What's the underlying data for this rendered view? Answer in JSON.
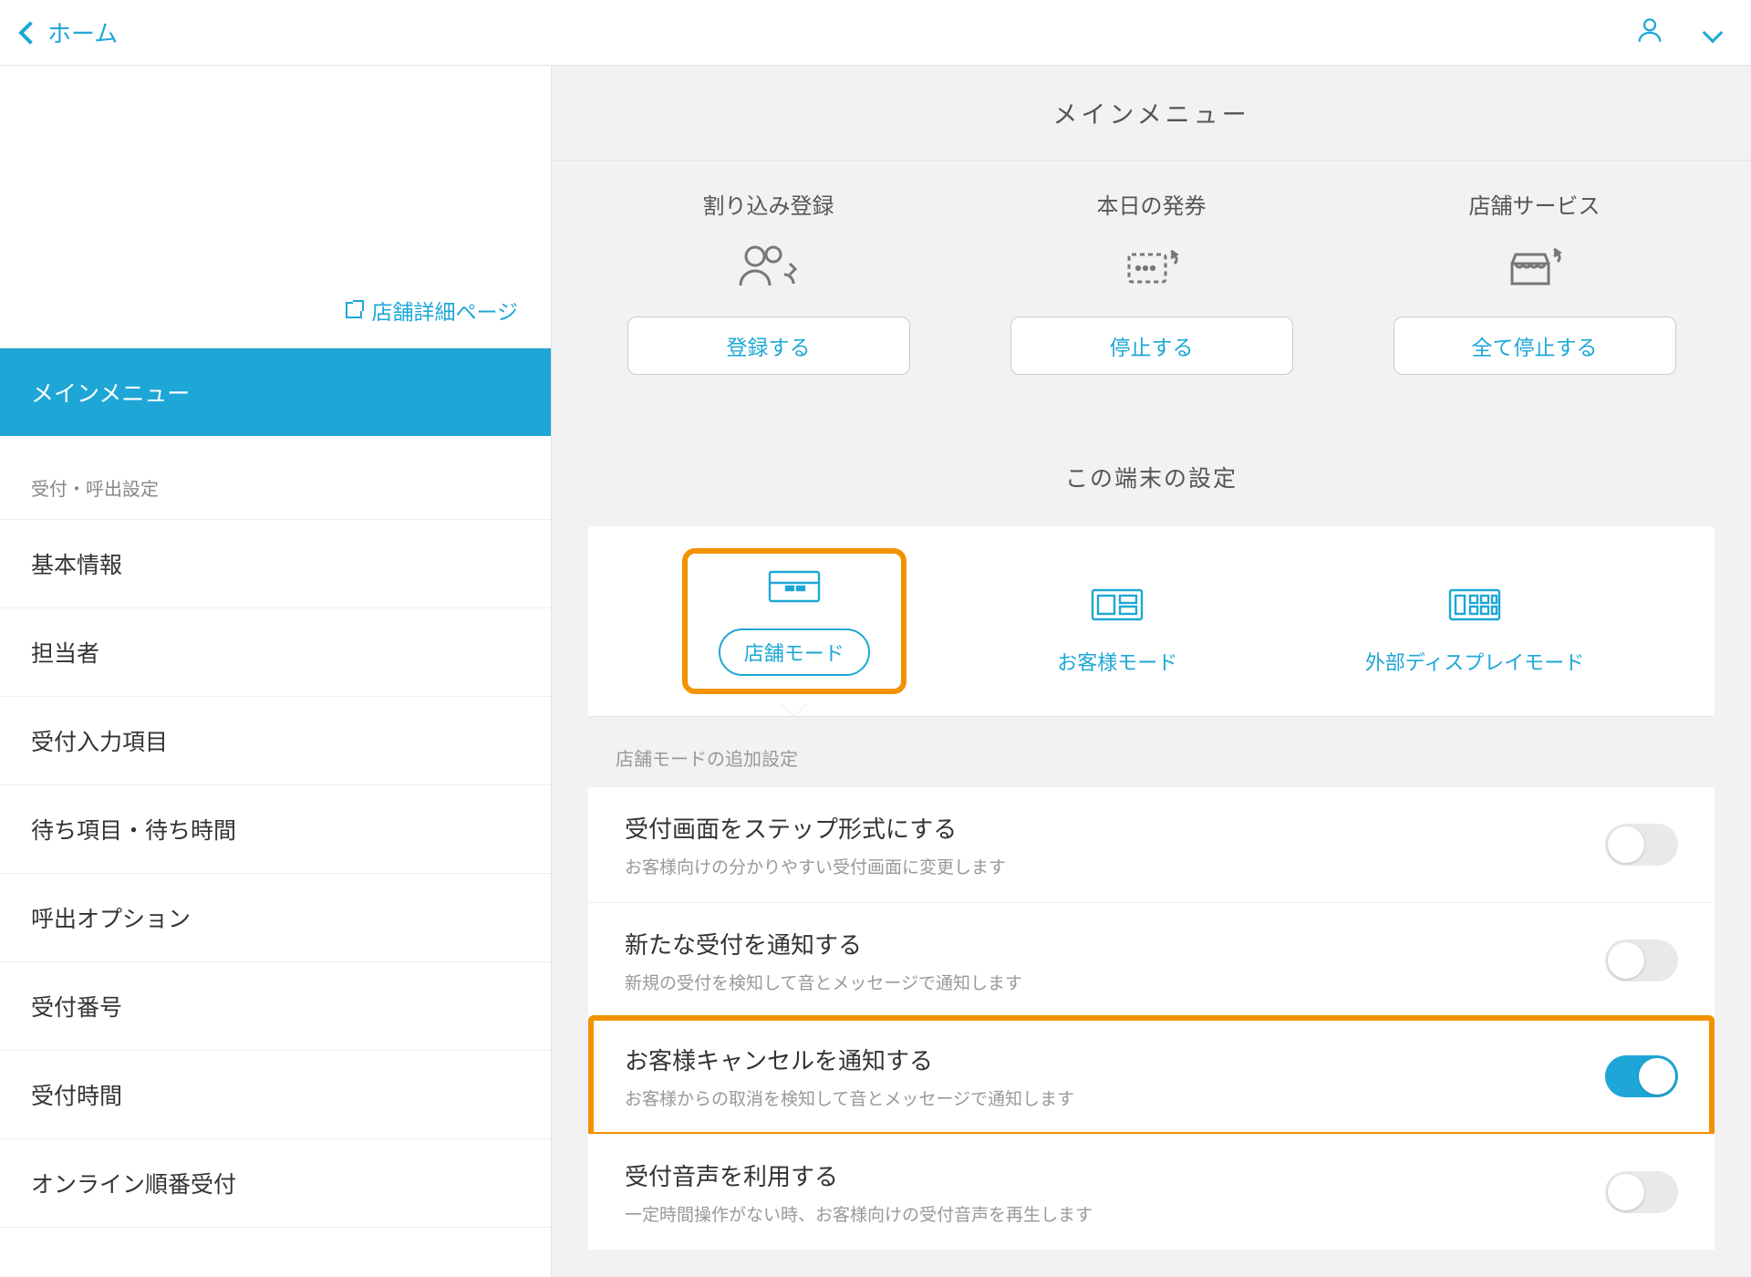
{
  "colors": {
    "accent": "#1ea7d6",
    "highlight": "#f39200"
  },
  "topbar": {
    "back_label": "ホーム"
  },
  "sidebar": {
    "shop_detail_link": "店舗詳細ページ",
    "active_label": "メインメニュー",
    "section_label": "受付・呼出設定",
    "items": [
      "基本情報",
      "担当者",
      "受付入力項目",
      "待ち項目・待ち時間",
      "呼出オプション",
      "受付番号",
      "受付時間",
      "オンライン順番受付"
    ]
  },
  "main": {
    "title": "メインメニュー",
    "actions": [
      {
        "label": "割り込み登録",
        "button": "登録する",
        "icon": "people-cycle"
      },
      {
        "label": "本日の発券",
        "button": "停止する",
        "icon": "ticket-cycle"
      },
      {
        "label": "店舗サービス",
        "button": "全て停止する",
        "icon": "store-cycle"
      }
    ],
    "device_settings_title": "この端末の設定",
    "modes": [
      {
        "label": "店舗モード",
        "active": true
      },
      {
        "label": "お客様モード",
        "active": false
      },
      {
        "label": "外部ディスプレイモード",
        "active": false
      }
    ],
    "mode_settings_label": "店舗モードの追加設定",
    "settings": [
      {
        "title": "受付画面をステップ形式にする",
        "desc": "お客様向けの分かりやすい受付画面に変更します",
        "on": false,
        "highlight": false
      },
      {
        "title": "新たな受付を通知する",
        "desc": "新規の受付を検知して音とメッセージで通知します",
        "on": false,
        "highlight": false
      },
      {
        "title": "お客様キャンセルを通知する",
        "desc": "お客様からの取消を検知して音とメッセージで通知します",
        "on": true,
        "highlight": true
      },
      {
        "title": "受付音声を利用する",
        "desc": "一定時間操作がない時、お客様向けの受付音声を再生します",
        "on": false,
        "highlight": false
      }
    ]
  }
}
